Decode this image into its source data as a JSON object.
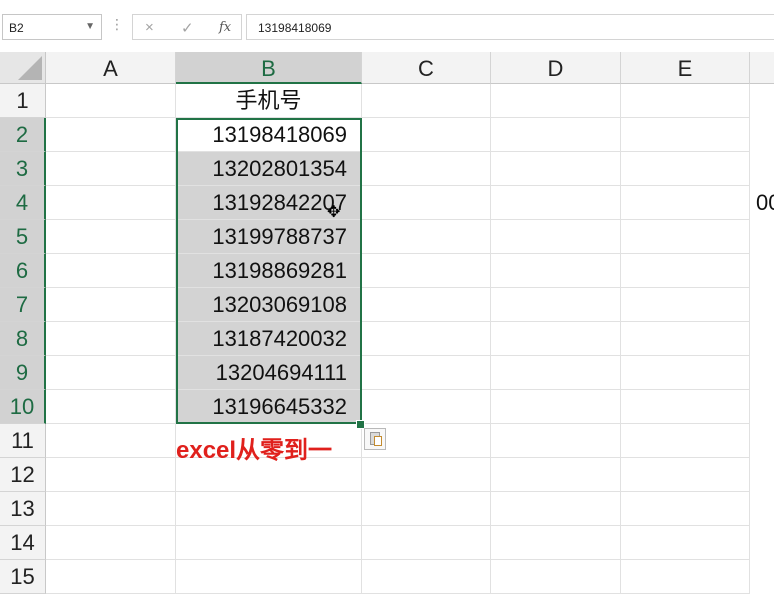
{
  "formula_bar": {
    "name_box": "B2",
    "cancel_icon": "×",
    "enter_icon": "✓",
    "fx_label": "fx",
    "formula_value": "13198418069"
  },
  "columns": [
    "A",
    "B",
    "C",
    "D",
    "E"
  ],
  "rows": [
    "1",
    "2",
    "3",
    "4",
    "5",
    "6",
    "7",
    "8",
    "9",
    "10",
    "11",
    "12",
    "13",
    "14",
    "15"
  ],
  "cells": {
    "B1": "手机号",
    "B2": "13198418069",
    "B3": "13202801354",
    "B4": "13192842207",
    "B5": "13199788737",
    "B6": "13198869281",
    "B7": "13203069108",
    "B8": "13187420032",
    "B9": "13204694111",
    "B10": "13196645332",
    "F4": "00"
  },
  "overlay_text": "excel从零到一",
  "colors": {
    "selection": "#217346",
    "shade": "#d3d3d3",
    "watermark": "#e0201c"
  }
}
